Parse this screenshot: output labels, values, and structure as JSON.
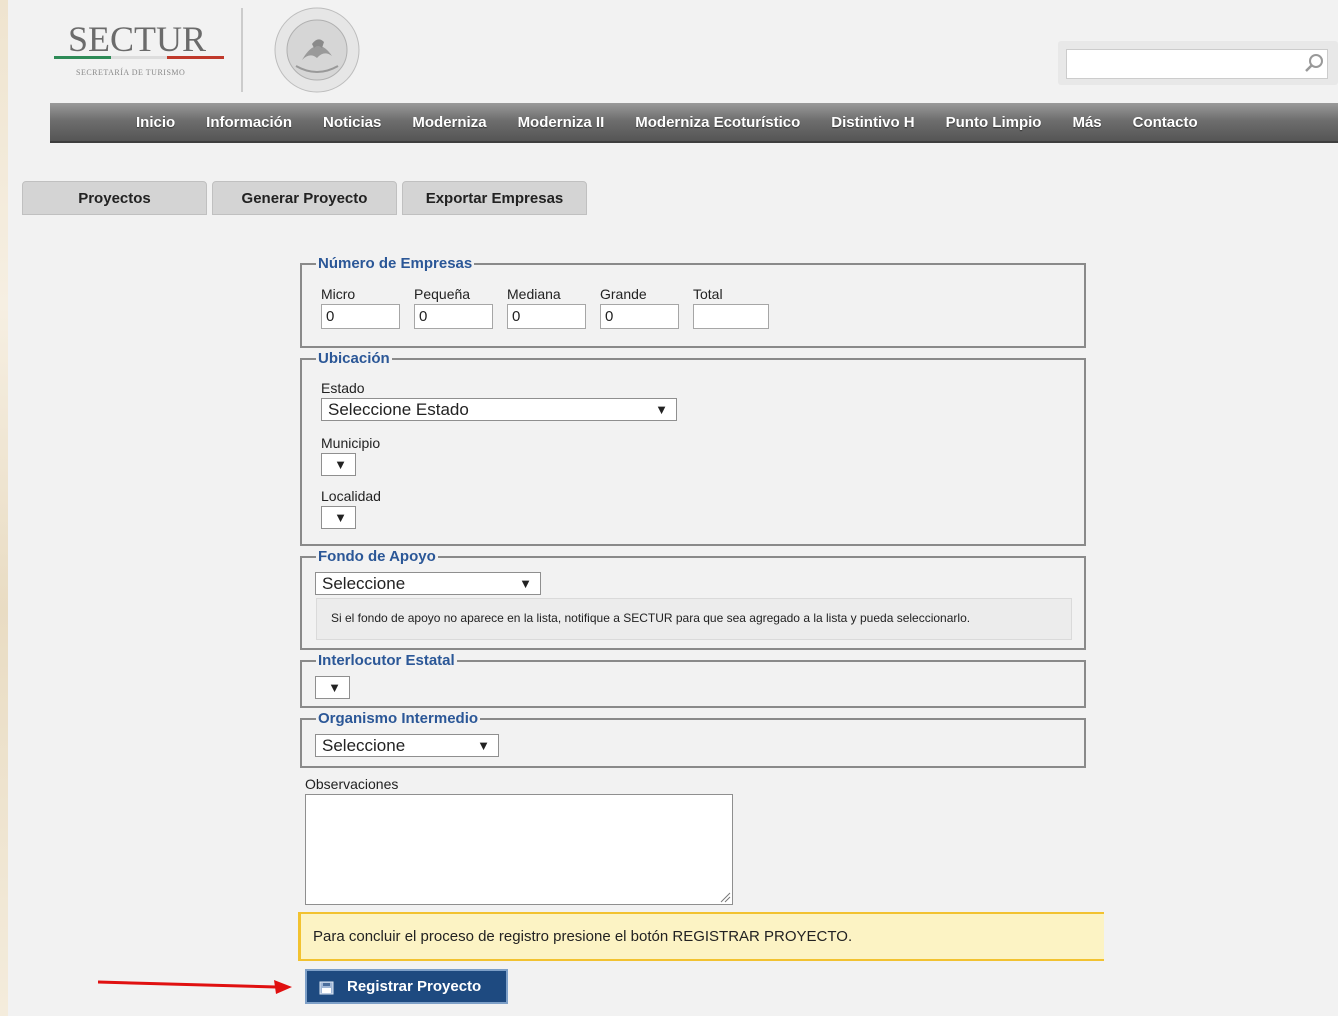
{
  "header": {
    "logo_text": "SECTUR",
    "logo_subtitle": "SECRETARÍA DE TURISMO",
    "search": {
      "value": "",
      "placeholder": ""
    }
  },
  "nav": {
    "items": [
      "Inicio",
      "Información",
      "Noticias",
      "Moderniza",
      "Moderniza II",
      "Moderniza Ecoturístico",
      "Distintivo H",
      "Punto Limpio",
      "Más",
      "Contacto"
    ]
  },
  "tabs": [
    "Proyectos",
    "Generar Proyecto",
    "Exportar Empresas"
  ],
  "numero_empresas": {
    "legend": "Número de Empresas",
    "fields": [
      {
        "label": "Micro",
        "value": "0"
      },
      {
        "label": "Pequeña",
        "value": "0"
      },
      {
        "label": "Mediana",
        "value": "0"
      },
      {
        "label": "Grande",
        "value": "0"
      },
      {
        "label": "Total",
        "value": ""
      }
    ]
  },
  "ubicacion": {
    "legend": "Ubicación",
    "estado_label": "Estado",
    "estado_value": "Seleccione Estado",
    "municipio_label": "Municipio",
    "municipio_value": "",
    "localidad_label": "Localidad",
    "localidad_value": ""
  },
  "fondo_apoyo": {
    "legend": "Fondo de Apoyo",
    "value": "Seleccione",
    "note": "Si el fondo de apoyo no aparece en la lista, notifique a SECTUR para que sea agregado a la lista y pueda seleccionarlo."
  },
  "interlocutor": {
    "legend": "Interlocutor Estatal",
    "value": ""
  },
  "organismo": {
    "legend": "Organismo Intermedio",
    "value": "Seleccione"
  },
  "observaciones": {
    "label": "Observaciones",
    "value": ""
  },
  "info_message": "Para concluir el proceso de registro presione el botón REGISTRAR PROYECTO.",
  "register_button": "Registrar Proyecto",
  "colors": {
    "legend": "#2b5797",
    "button": "#1e4a80",
    "info_bg": "#fcf3c4",
    "arrow": "#e01010"
  }
}
